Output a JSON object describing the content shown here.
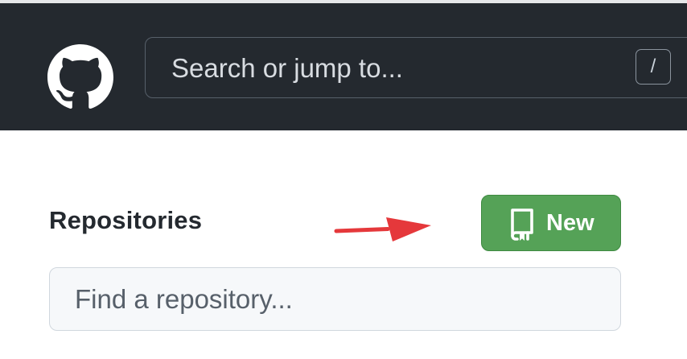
{
  "header": {
    "logo_icon": "github-octocat-icon",
    "search": {
      "placeholder": "Search or jump to...",
      "value": "",
      "shortcut_key": "/"
    }
  },
  "main": {
    "section_title": "Repositories",
    "annotation_arrow": {
      "icon": "red-arrow-icon",
      "color": "#e5383b"
    },
    "new_button": {
      "label": "New",
      "icon": "repo-book-icon",
      "color": "#55a257"
    },
    "find_repository": {
      "placeholder": "Find a repository...",
      "value": ""
    }
  }
}
